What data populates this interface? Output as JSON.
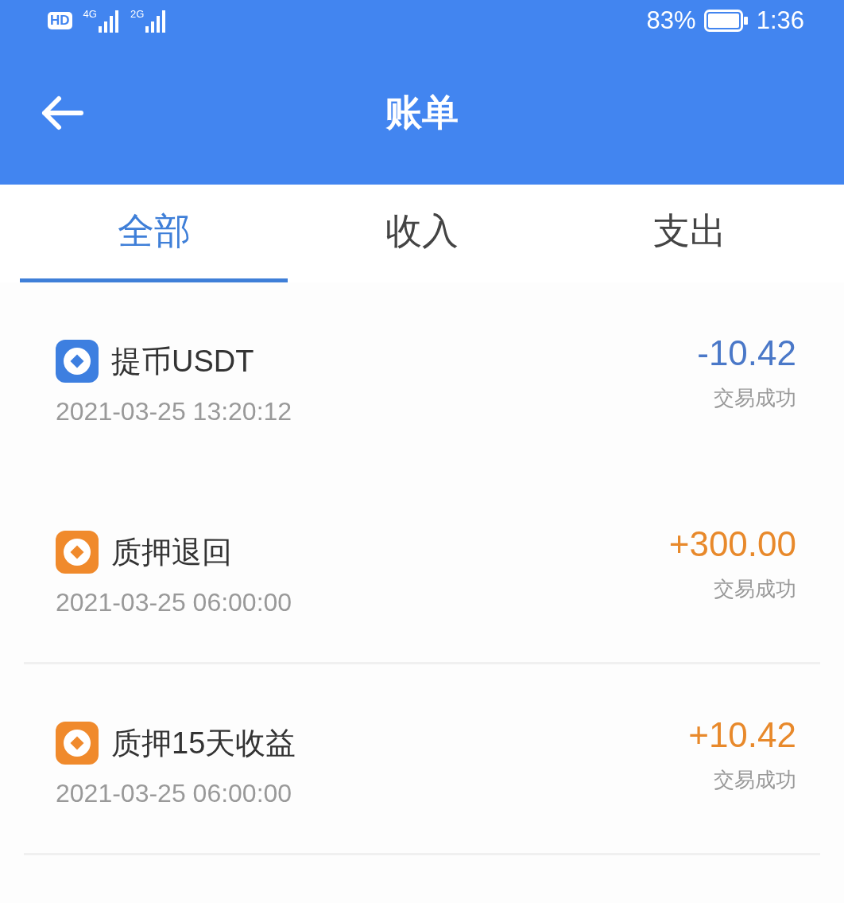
{
  "status_bar": {
    "hd": "HD",
    "networks": [
      "4G",
      "2G"
    ],
    "battery": "83%",
    "time": "1:36"
  },
  "header": {
    "title": "账单"
  },
  "tabs": [
    {
      "label": "全部",
      "selected": true
    },
    {
      "label": "收入",
      "selected": false
    },
    {
      "label": "支出",
      "selected": false
    }
  ],
  "transactions": [
    {
      "title": "提币USDT",
      "time": "2021-03-25 13:20:12",
      "amount": "-10.42",
      "status": "交易成功",
      "kind": "expense",
      "color": "#3d7fe0",
      "divider": false
    },
    {
      "title": "质押退回",
      "time": "2021-03-25 06:00:00",
      "amount": "+300.00",
      "status": "交易成功",
      "kind": "income",
      "color": "#f08a2c",
      "divider": true
    },
    {
      "title": "质押15天收益",
      "time": "2021-03-25 06:00:00",
      "amount": "+10.42",
      "status": "交易成功",
      "kind": "income",
      "color": "#f08a2c",
      "divider": true
    }
  ]
}
